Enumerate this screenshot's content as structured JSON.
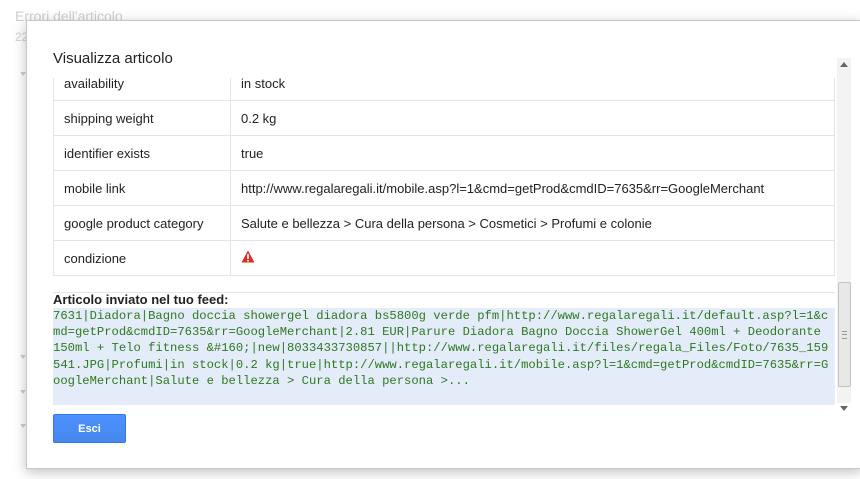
{
  "background": {
    "title": "Errori dell'articolo",
    "count": "22"
  },
  "dialog": {
    "title": "Visualizza articolo",
    "rows": [
      {
        "key": "availability",
        "value": "in stock"
      },
      {
        "key": "shipping weight",
        "value": "0.2 kg"
      },
      {
        "key": "identifier exists",
        "value": "true"
      },
      {
        "key": "mobile link",
        "value": "http://www.regalaregali.it/mobile.asp?l=1&cmd=getProd&cmdID=7635&rr=GoogleMerchant"
      },
      {
        "key": "google product category",
        "value": "Salute e bellezza > Cura della persona > Cosmetici > Profumi e colonie"
      },
      {
        "key": "condizione",
        "value": "",
        "icon": "warning-icon"
      }
    ],
    "feed_label": "Articolo inviato nel tuo feed:",
    "feed_text": "7631|Diadora|Bagno doccia showergel diadora bs5800g verde pfm|http://www.regalaregali.it/default.asp?l=1&cmd=getProd&cmdID=7635&rr=GoogleMerchant|2.81 EUR|Parure Diadora Bagno Doccia ShowerGel 400ml + Deodorante 150ml + Telo fitness &#160;|new|8033433730857||http://www.regalaregali.it/files/regala_Files/Foto/7635_159541.JPG|Profumi|in stock|0.2 kg|true|http://www.regalaregali.it/mobile.asp?l=1&cmd=getProd&cmdID=7635&rr=GoogleMerchant|Salute e bellezza > Cura della persona >...",
    "close_button": "Esci"
  },
  "colors": {
    "button": "#4d90fe",
    "feed_bg": "#e5ecf9",
    "feed_text": "#2b7a1f",
    "warning": "#d93025"
  }
}
